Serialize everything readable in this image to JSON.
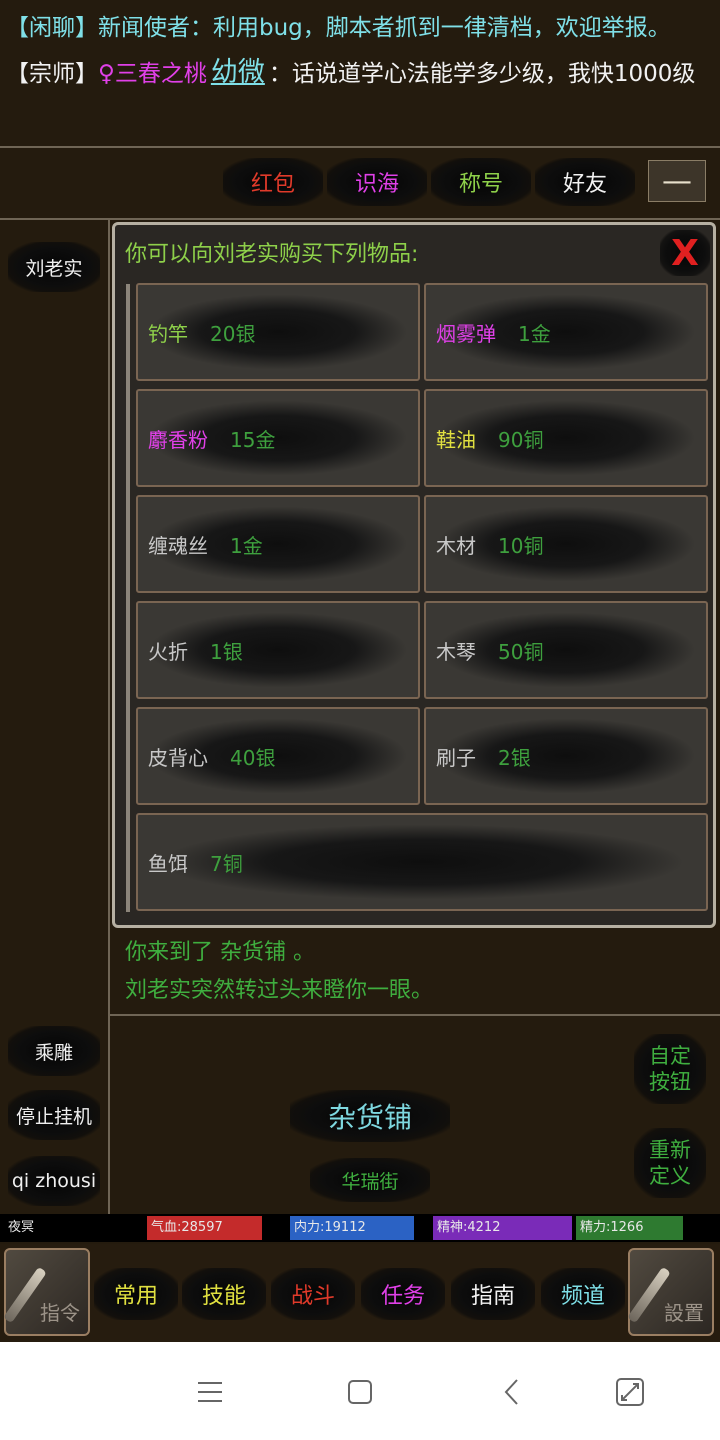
{
  "chat": {
    "line1": {
      "channel": "【闲聊】",
      "speaker": "新闻使者：",
      "text": "利用bug，脚本者抓到一律清档，欢迎举报。"
    },
    "line2": {
      "channel": "【宗师】",
      "gender": "♀",
      "name": "三春之桃",
      "link": "幼微",
      "text": "：话说道学心法能学多少级，我快1000级"
    }
  },
  "top_tabs": [
    {
      "label": "红包",
      "color": "#e03a2a"
    },
    {
      "label": "识海",
      "color": "#e040e8"
    },
    {
      "label": "称号",
      "color": "#8ed04a"
    },
    {
      "label": "好友",
      "color": "#f2f2f2"
    }
  ],
  "minus_label": "—",
  "npc_button": "刘老实",
  "shop": {
    "title": "你可以向刘老实购买下列物品:",
    "close": "X",
    "items": [
      {
        "name": "钓竿",
        "price": "20银",
        "color": "#8ed04a"
      },
      {
        "name": "烟雾弹",
        "price": "1金",
        "color": "#e040e8"
      },
      {
        "name": "麝香粉",
        "price": "15金",
        "color": "#e040e8"
      },
      {
        "name": "鞋油",
        "price": "90铜",
        "color": "#e0e040"
      },
      {
        "name": "缠魂丝",
        "price": "1金",
        "color": "#c8c8c8"
      },
      {
        "name": "木材",
        "price": "10铜",
        "color": "#c8c8c8"
      },
      {
        "name": "火折",
        "price": "1银",
        "color": "#c8c8c8"
      },
      {
        "name": "木琴",
        "price": "50铜",
        "color": "#c8c8c8"
      },
      {
        "name": "皮背心",
        "price": "40银",
        "color": "#c8c8c8"
      },
      {
        "name": "刷子",
        "price": "2银",
        "color": "#c8c8c8"
      },
      {
        "name": "鱼饵",
        "price": "7铜",
        "color": "#c8c8c8"
      }
    ]
  },
  "log": [
    "你来到了 杂货铺 。",
    "刘老实突然转过头来瞪你一眼。"
  ],
  "left_buttons": [
    "乘雕",
    "停止挂机",
    "qi zhousi"
  ],
  "right_buttons": [
    "自定\n按钮",
    "重新\n定义"
  ],
  "location": {
    "title": "杂货铺",
    "street": "华瑞街"
  },
  "status": {
    "name": "夜冥",
    "bars": [
      {
        "label": "气血:28597",
        "color": "#c42b2b"
      },
      {
        "label": "内力:19112",
        "color": "#2b62c4"
      },
      {
        "label": "精神:4212",
        "color": "#7a2bb8"
      },
      {
        "label": "精力:1266",
        "color": "#2e7a30"
      }
    ]
  },
  "bottom_nav": {
    "left_icon_label": "指令",
    "right_icon_label": "設置",
    "tabs": [
      {
        "label": "常用",
        "color": "#e0e040"
      },
      {
        "label": "技能",
        "color": "#e0e040"
      },
      {
        "label": "战斗",
        "color": "#e03a2a"
      },
      {
        "label": "任务",
        "color": "#e040e8"
      },
      {
        "label": "指南",
        "color": "#f2f2f2"
      },
      {
        "label": "频道",
        "color": "#7fe0e8"
      }
    ]
  },
  "system_nav": [
    "menu-icon",
    "home-icon",
    "back-icon",
    "rotate-icon"
  ]
}
